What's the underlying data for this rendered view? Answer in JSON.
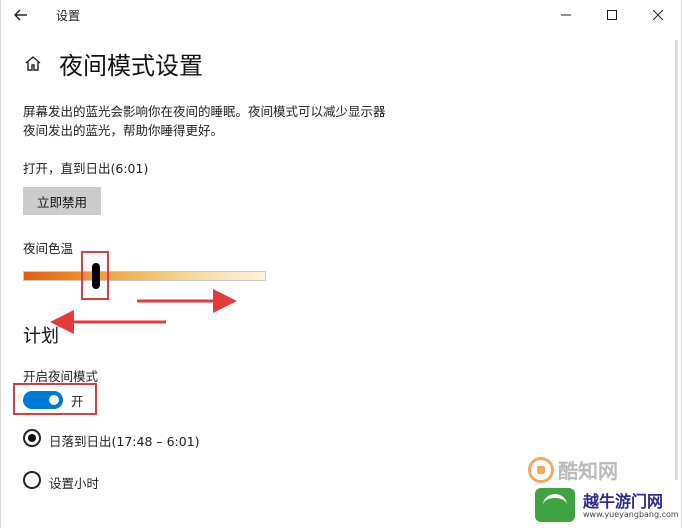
{
  "window": {
    "title": "设置",
    "back_icon": "back-arrow-icon",
    "minimize_icon": "minimize-icon",
    "maximize_icon": "maximize-icon",
    "close_icon": "close-icon"
  },
  "header": {
    "home_icon": "home-icon",
    "title": "夜间模式设置"
  },
  "description": {
    "line1": "屏幕发出的蓝光会影响你在夜间的睡眠。夜间模式可以减少显示器",
    "line2": "夜间发出的蓝光，帮助你睡得更好。"
  },
  "status": {
    "text": "打开，直到日出(6:01)"
  },
  "disable_button": {
    "label": "立即禁用"
  },
  "color_temperature": {
    "label": "夜间色温",
    "value": 0.3,
    "gradient_colors": [
      "#e35d10",
      "#f3b657",
      "#fcf3dc"
    ]
  },
  "schedule": {
    "section_title": "计划",
    "toggle_label": "开启夜间模式",
    "toggle_state": "开",
    "toggle_on": true,
    "accent_color": "#0078d7",
    "options": [
      {
        "label": "日落到日出(17:48 – 6:01)",
        "selected": true
      },
      {
        "label": "设置小时",
        "selected": false
      }
    ]
  },
  "annotations": {
    "highlight_color": "#e33b3b"
  },
  "watermarks": {
    "site1": "酷知网",
    "site2": "越牛游门网",
    "site2_url": "www.yueyangbang.com"
  }
}
